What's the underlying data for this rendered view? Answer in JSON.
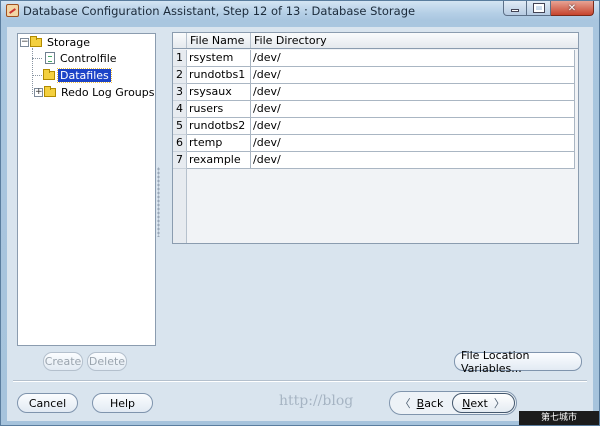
{
  "window": {
    "title": "Database Configuration Assistant, Step 12 of 13 : Database Storage",
    "minimize_glyph": "—",
    "maximize_glyph": "□",
    "close_glyph": "✕"
  },
  "tree": {
    "root": {
      "label": "Storage",
      "expander": "⊖"
    },
    "items": [
      {
        "label": "Controlfile",
        "icon": "controlfile-icon"
      },
      {
        "label": "Datafiles",
        "icon": "folder-icon",
        "selected": true
      },
      {
        "label": "Redo Log Groups",
        "icon": "folder-icon",
        "expander": "⊕"
      }
    ]
  },
  "tree_buttons": {
    "create": "Create",
    "delete": "Delete"
  },
  "table": {
    "headers": {
      "num": "",
      "name": "File Name",
      "dir": "File Directory"
    },
    "rows": [
      {
        "num": "1",
        "name": "rsystem",
        "dir": "/dev/"
      },
      {
        "num": "2",
        "name": "rundotbs1",
        "dir": "/dev/"
      },
      {
        "num": "3",
        "name": "rsysaux",
        "dir": "/dev/"
      },
      {
        "num": "4",
        "name": "rusers",
        "dir": "/dev/"
      },
      {
        "num": "5",
        "name": "rundotbs2",
        "dir": "/dev/"
      },
      {
        "num": "6",
        "name": "rtemp",
        "dir": "/dev/"
      },
      {
        "num": "7",
        "name": "rexample",
        "dir": "/dev/"
      }
    ]
  },
  "file_location_button": "File Location Variables...",
  "footer": {
    "cancel": "Cancel",
    "help": "Help",
    "back": "Back",
    "next": "Next",
    "back_chevron": "〈",
    "next_chevron": "〉"
  },
  "watermark": "http://blog",
  "corner_badge": "第七城市"
}
